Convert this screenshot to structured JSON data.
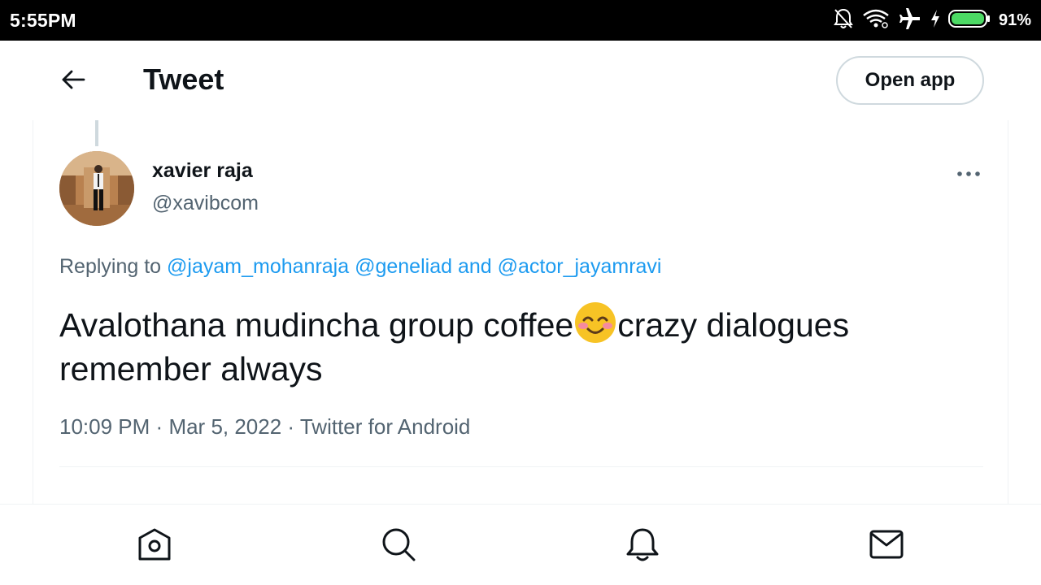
{
  "status_bar": {
    "time": "5:55PM",
    "battery_percent": "91%",
    "icons": [
      "notifications-off-icon",
      "wifi-icon",
      "airplane-icon",
      "charging-icon",
      "battery-icon"
    ]
  },
  "header": {
    "back_icon": "arrow-left-icon",
    "title": "Tweet",
    "open_app_label": "Open app"
  },
  "tweet": {
    "author_name": "xavier raja",
    "author_handle": "@xavibcom",
    "replying_prefix": "Replying to",
    "replying_mentions": [
      "@jayam_mohanraja",
      "@geneliad"
    ],
    "replying_and": "and",
    "replying_last": "@actor_jayamravi",
    "text_before_emoji": "Avalothana mudincha group coffee",
    "emoji": "smiling-face-with-smiling-eyes",
    "text_after_emoji": "crazy dialogues remember always",
    "time": "10:09 PM",
    "date": "Mar 5, 2022",
    "source": "Twitter for Android",
    "separator": "·"
  },
  "bottom_nav": [
    {
      "name": "home",
      "icon": "home-icon"
    },
    {
      "name": "search",
      "icon": "search-icon"
    },
    {
      "name": "notifications",
      "icon": "bell-icon"
    },
    {
      "name": "messages",
      "icon": "mail-icon"
    }
  ],
  "colors": {
    "link": "#1d9bf0",
    "secondary_text": "#536471",
    "primary_text": "#0f1419",
    "battery": "#4cd964"
  }
}
